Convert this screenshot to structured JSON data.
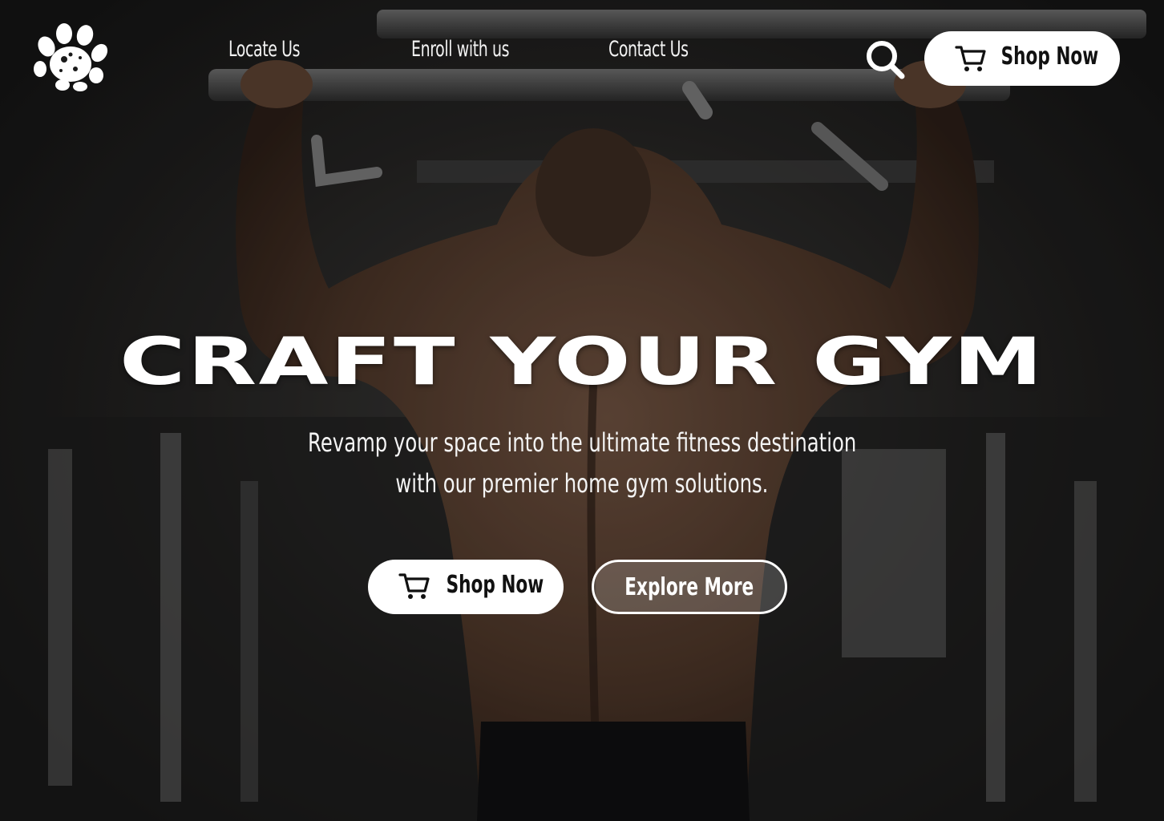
{
  "nav": {
    "logo_icon": "paw-print-icon",
    "links": [
      "Locate Us",
      "Enroll with us",
      "Contact Us"
    ],
    "search_icon": "search-icon",
    "shop_button": {
      "label": "Shop Now",
      "icon": "cart-icon"
    }
  },
  "hero": {
    "title": "CRAFT YOUR GYM",
    "subtitle_line1": "Revamp your space into the ultimate fitness destination",
    "subtitle_line2": "with our premier home gym solutions.",
    "primary_cta": {
      "label": "Shop Now",
      "icon": "cart-icon"
    },
    "secondary_cta": {
      "label": "Explore More"
    }
  },
  "colors": {
    "text": "#ffffff",
    "button_bg": "#ffffff",
    "button_text": "#111111",
    "background": "#1a1a1a"
  }
}
